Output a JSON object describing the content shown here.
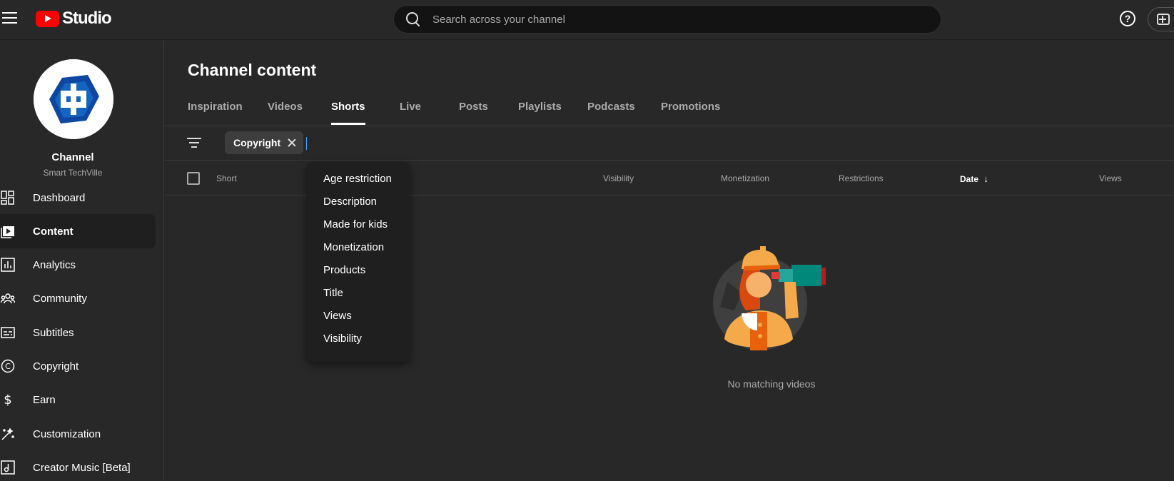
{
  "header": {
    "logo_text": "Studio",
    "search_placeholder": "Search across your channel",
    "help_glyph": "?"
  },
  "sidebar": {
    "channel_label": "Channel",
    "channel_name": "Smart TechVille",
    "items": [
      {
        "label": "Dashboard",
        "icon": "dashboard-icon"
      },
      {
        "label": "Content",
        "icon": "content-icon",
        "active": true
      },
      {
        "label": "Analytics",
        "icon": "analytics-icon"
      },
      {
        "label": "Community",
        "icon": "community-icon"
      },
      {
        "label": "Subtitles",
        "icon": "subtitles-icon"
      },
      {
        "label": "Copyright",
        "icon": "copyright-icon"
      },
      {
        "label": "Earn",
        "icon": "earn-icon"
      },
      {
        "label": "Customization",
        "icon": "customization-icon"
      },
      {
        "label": "Creator Music [Beta]",
        "icon": "creator-music-icon"
      }
    ]
  },
  "main": {
    "title": "Channel content",
    "tabs": [
      {
        "label": "Inspiration"
      },
      {
        "label": "Videos"
      },
      {
        "label": "Shorts",
        "active": true
      },
      {
        "label": "Live"
      },
      {
        "label": "Posts"
      },
      {
        "label": "Playlists"
      },
      {
        "label": "Podcasts"
      },
      {
        "label": "Promotions"
      }
    ],
    "filter_chip": "Copyright",
    "columns": {
      "short": "Short",
      "visibility": "Visibility",
      "monetization": "Monetization",
      "restrictions": "Restrictions",
      "date": "Date",
      "views": "Views"
    },
    "empty_message": "No matching videos"
  },
  "filter_menu": {
    "options": [
      "Age restriction",
      "Description",
      "Made for kids",
      "Monetization",
      "Products",
      "Title",
      "Views",
      "Visibility"
    ]
  },
  "colors": {
    "background": "#282828",
    "accent": "#3ea6ff",
    "brand_red": "#ff0000"
  }
}
